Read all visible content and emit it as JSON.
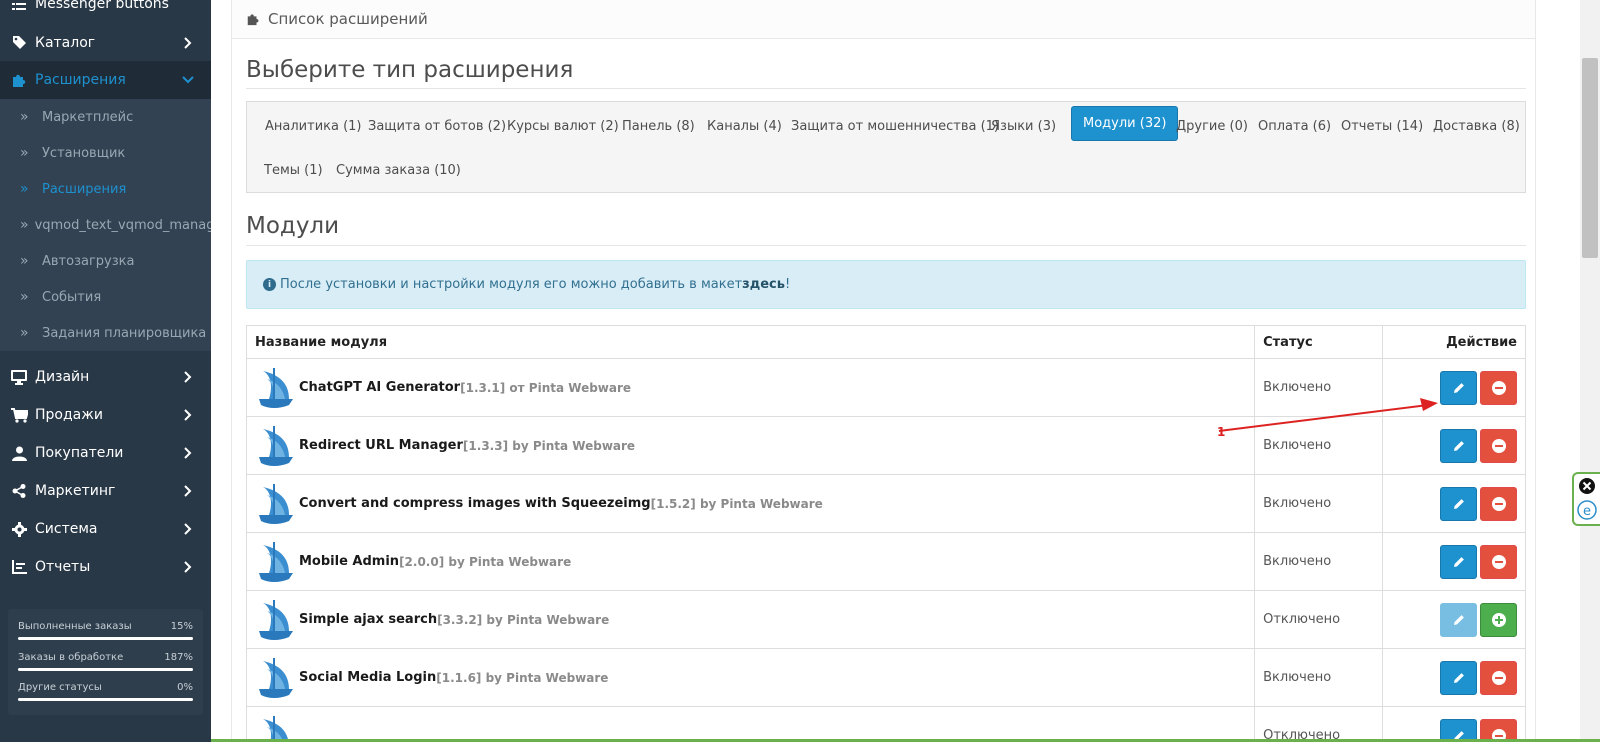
{
  "sidebar": {
    "top_item": "Messenger buttons",
    "items": [
      {
        "label": "Каталог",
        "icon": "tag-icon"
      },
      {
        "label": "Расширения",
        "icon": "puzzle-icon",
        "expanded": true
      },
      {
        "label": "Дизайн",
        "icon": "desktop-icon"
      },
      {
        "label": "Продажи",
        "icon": "cart-icon"
      },
      {
        "label": "Покупатели",
        "icon": "user-icon"
      },
      {
        "label": "Маркетинг",
        "icon": "share-icon"
      },
      {
        "label": "Система",
        "icon": "gear-icon"
      },
      {
        "label": "Отчеты",
        "icon": "bar-chart-icon"
      }
    ],
    "subitems": [
      {
        "label": "Маркетплейс"
      },
      {
        "label": "Установщик"
      },
      {
        "label": "Расширения",
        "active": true
      },
      {
        "label": "vqmod_text_vqmod_manager"
      },
      {
        "label": "Автозагрузка"
      },
      {
        "label": "События"
      },
      {
        "label": "Задания планировщика"
      }
    ],
    "stats": [
      {
        "label": "Выполненные заказы",
        "percent_text": "15%",
        "fill": 1.0
      },
      {
        "label": "Заказы в обработке",
        "percent_text": "187%",
        "fill": 1.0
      },
      {
        "label": "Другие статусы",
        "percent_text": "0%",
        "fill": 1.0
      }
    ]
  },
  "panel": {
    "heading": "Список расширений",
    "choose_title": "Выберите тип расширения",
    "types": [
      "Аналитика (1)",
      "Защита от ботов (2)",
      "Курсы валют (2)",
      "Панель (8)",
      "Каналы (4)",
      "Защита от мошенничества (1)",
      "Языки (3)",
      "Модули (32)",
      "Другие (0)",
      "Оплата (6)",
      "Отчеты (14)",
      "Доставка (8)",
      "Темы (1)",
      "Сумма заказа (10)"
    ],
    "active_type": "Модули (32)",
    "section_title": "Модули",
    "alert_text": "После установки и настройки модуля его можно добавить в макет ",
    "alert_link": "здесь",
    "alert_end": "!"
  },
  "table": {
    "col_name": "Название модуля",
    "col_status": "Статус",
    "col_action": "Действие",
    "rows": [
      {
        "title": "ChatGPT AI Generator",
        "meta": "[1.3.1] от Pinta Webware",
        "status": "Включено",
        "installed": true
      },
      {
        "title": "Redirect URL Manager",
        "meta": " [1.3.3] by Pinta Webware",
        "status": "Включено",
        "installed": true
      },
      {
        "title": "Convert and compress images with Squeezeimg",
        "meta": " [1.5.2] by Pinta Webware",
        "status": "Включено",
        "installed": true
      },
      {
        "title": "Mobile Admin",
        "meta": " [2.0.0] by Pinta Webware",
        "status": "Включено",
        "installed": true
      },
      {
        "title": "Simple ajax search",
        "meta": " [3.3.2] by Pinta Webware",
        "status": "Отключено",
        "installed": false
      },
      {
        "title": "Social Media Login",
        "meta": " [1.1.6] by Pinta Webware",
        "status": "Включено",
        "installed": true
      },
      {
        "title": "",
        "meta": "",
        "status": "Отключено",
        "installed": true
      }
    ]
  },
  "annotation": {
    "number": "1",
    "color": "#dd2222"
  },
  "colors": {
    "sidebar_bg": "#293846",
    "accent": "#1e91cf",
    "danger": "#e3503e",
    "success": "#4cae4c"
  }
}
